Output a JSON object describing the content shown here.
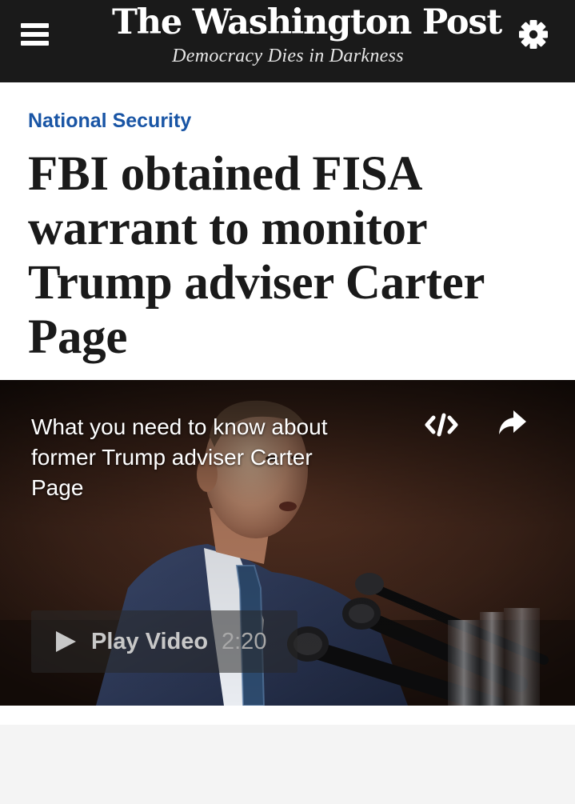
{
  "header": {
    "logo_text": "The Washington Post",
    "tagline": "Democracy Dies in Darkness",
    "menu_icon": "hamburger-menu-icon",
    "settings_icon": "gear-icon",
    "background_color": "#1a1a1a"
  },
  "article": {
    "section": "National Security",
    "section_color": "#1955a5",
    "headline": "FBI obtained FISA warrant to monitor Trump adviser Carter Page"
  },
  "video": {
    "title": "What you need to know about former Trump adviser Carter Page",
    "embed_icon": "code-embed-icon",
    "share_icon": "share-arrow-icon",
    "play_icon": "play-triangle-icon",
    "play_label": "Play Video",
    "duration": "2:20"
  }
}
